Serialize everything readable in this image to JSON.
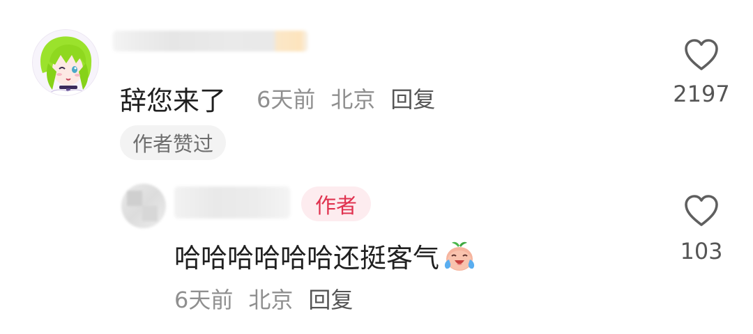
{
  "comment": {
    "text": "辞您来了",
    "time": "6天前",
    "location": "北京",
    "reply_label": "回复",
    "liked_badge": "作者赞过",
    "like_count": "2197",
    "like_icon": "heart-outline-icon"
  },
  "reply": {
    "author_badge": "作者",
    "text": "哈哈哈哈哈哈还挺客气",
    "emoji": "laughing-crying-emoji",
    "time": "6天前",
    "location": "北京",
    "reply_label": "回复",
    "like_count": "103",
    "like_icon": "heart-outline-icon"
  },
  "colors": {
    "author_badge_bg": "#fdecef",
    "author_badge_text": "#e0324f",
    "meta_gray": "#8f8f8f",
    "liked_badge_bg": "#f3f3f3"
  }
}
